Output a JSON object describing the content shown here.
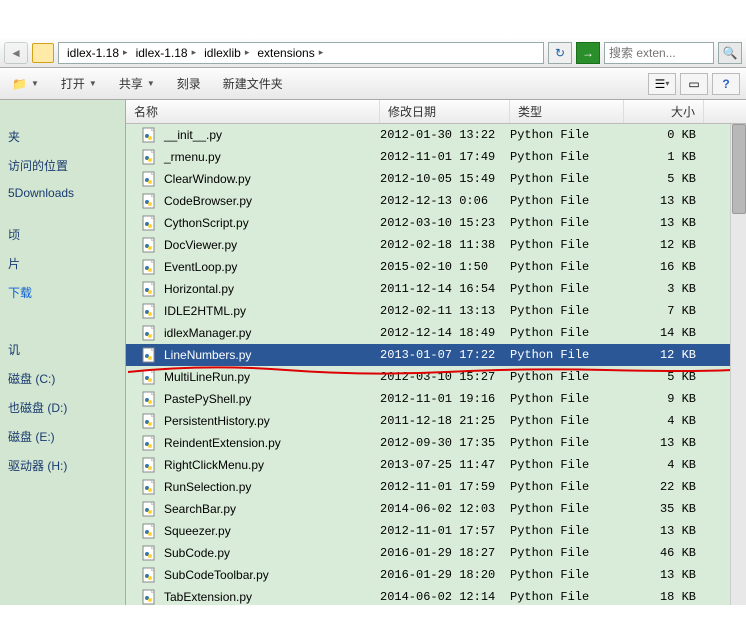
{
  "breadcrumb": [
    {
      "label": "idlex-1.18"
    },
    {
      "label": "idlex-1.18"
    },
    {
      "label": "idlexlib"
    },
    {
      "label": "extensions"
    }
  ],
  "search_placeholder": "搜索 exten...",
  "toolbar": {
    "open": "打开",
    "share": "共享",
    "burn": "刻录",
    "newfolder": "新建文件夹"
  },
  "sidebar": {
    "items": [
      "",
      "夹",
      "访问的位置",
      "5Downloads",
      "",
      "顷",
      "片",
      "下载",
      "",
      "",
      "讥",
      "磁盘 (C:)",
      "也磁盘 (D:)",
      "磁盘 (E:)",
      "驱动器 (H:)"
    ]
  },
  "columns": {
    "name": "名称",
    "date": "修改日期",
    "type": "类型",
    "size": "大小"
  },
  "selected_index": 10,
  "files": [
    {
      "name": "__init__.py",
      "date": "2012-01-30 13:22",
      "type": "Python File",
      "size": "0 KB"
    },
    {
      "name": "_rmenu.py",
      "date": "2012-11-01 17:49",
      "type": "Python File",
      "size": "1 KB"
    },
    {
      "name": "ClearWindow.py",
      "date": "2012-10-05 15:49",
      "type": "Python File",
      "size": "5 KB"
    },
    {
      "name": "CodeBrowser.py",
      "date": "2012-12-13 0:06",
      "type": "Python File",
      "size": "13 KB"
    },
    {
      "name": "CythonScript.py",
      "date": "2012-03-10 15:23",
      "type": "Python File",
      "size": "13 KB"
    },
    {
      "name": "DocViewer.py",
      "date": "2012-02-18 11:38",
      "type": "Python File",
      "size": "12 KB"
    },
    {
      "name": "EventLoop.py",
      "date": "2015-02-10 1:50",
      "type": "Python File",
      "size": "16 KB"
    },
    {
      "name": "Horizontal.py",
      "date": "2011-12-14 16:54",
      "type": "Python File",
      "size": "3 KB"
    },
    {
      "name": "IDLE2HTML.py",
      "date": "2012-02-11 13:13",
      "type": "Python File",
      "size": "7 KB"
    },
    {
      "name": "idlexManager.py",
      "date": "2012-12-14 18:49",
      "type": "Python File",
      "size": "14 KB"
    },
    {
      "name": "LineNumbers.py",
      "date": "2013-01-07 17:22",
      "type": "Python File",
      "size": "12 KB"
    },
    {
      "name": "MultiLineRun.py",
      "date": "2012-03-10 15:27",
      "type": "Python File",
      "size": "5 KB"
    },
    {
      "name": "PastePyShell.py",
      "date": "2012-11-01 19:16",
      "type": "Python File",
      "size": "9 KB"
    },
    {
      "name": "PersistentHistory.py",
      "date": "2011-12-18 21:25",
      "type": "Python File",
      "size": "4 KB"
    },
    {
      "name": "ReindentExtension.py",
      "date": "2012-09-30 17:35",
      "type": "Python File",
      "size": "13 KB"
    },
    {
      "name": "RightClickMenu.py",
      "date": "2013-07-25 11:47",
      "type": "Python File",
      "size": "4 KB"
    },
    {
      "name": "RunSelection.py",
      "date": "2012-11-01 17:59",
      "type": "Python File",
      "size": "22 KB"
    },
    {
      "name": "SearchBar.py",
      "date": "2014-06-02 12:03",
      "type": "Python File",
      "size": "35 KB"
    },
    {
      "name": "Squeezer.py",
      "date": "2012-11-01 17:57",
      "type": "Python File",
      "size": "13 KB"
    },
    {
      "name": "SubCode.py",
      "date": "2016-01-29 18:27",
      "type": "Python File",
      "size": "46 KB"
    },
    {
      "name": "SubCodeToolbar.py",
      "date": "2016-01-29 18:20",
      "type": "Python File",
      "size": "13 KB"
    },
    {
      "name": "TabExtension.py",
      "date": "2014-06-02 12:14",
      "type": "Python File",
      "size": "18 KB"
    }
  ]
}
